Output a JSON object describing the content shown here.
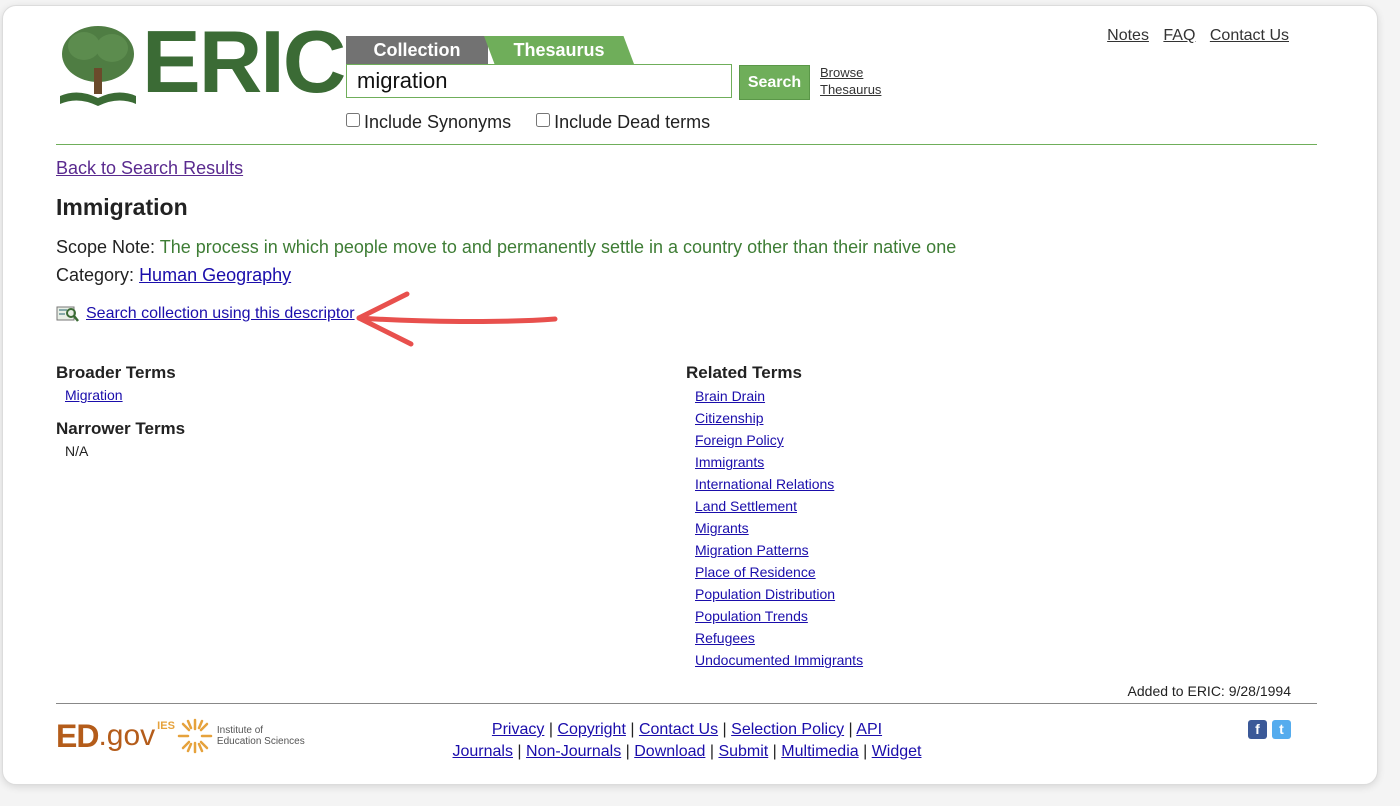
{
  "header": {
    "logo_text": "ERIC",
    "tabs": [
      {
        "label": "Collection"
      },
      {
        "label": "Thesaurus"
      }
    ],
    "search_value": "migration",
    "search_button": "Search",
    "browse_line1": "Browse",
    "browse_line2": "Thesaurus",
    "options": [
      {
        "label": "Include Synonyms",
        "checked": false
      },
      {
        "label": "Include Dead terms",
        "checked": false
      }
    ],
    "top_links": [
      "Notes",
      "FAQ",
      "Contact Us"
    ]
  },
  "content": {
    "back_link": "Back to Search Results",
    "title": "Immigration",
    "scope_label": "Scope Note:",
    "scope_value": "The process in which people move to and permanently settle in a country other than their native one",
    "category_label": "Category:",
    "category_value": "Human Geography",
    "search_descriptor": "Search collection using this descriptor",
    "broader_heading": "Broader Terms",
    "broader_terms": [
      "Migration"
    ],
    "narrower_heading": "Narrower Terms",
    "narrower_terms": [
      "N/A"
    ],
    "related_heading": "Related Terms",
    "related_terms": [
      "Brain Drain",
      "Citizenship",
      "Foreign Policy",
      "Immigrants",
      "International Relations",
      "Land Settlement",
      "Migrants",
      "Migration Patterns",
      "Place of Residence",
      "Population Distribution",
      "Population Trends",
      "Refugees",
      "Undocumented Immigrants"
    ],
    "added": "Added to ERIC: 9/28/1994"
  },
  "footer": {
    "ed": "ED",
    "gov": ".gov",
    "ies": "IES",
    "ies_line1": "Institute of",
    "ies_line2": "Education Sciences",
    "row1": [
      "Privacy",
      "Copyright",
      "Contact Us",
      "Selection Policy",
      "API"
    ],
    "row2": [
      "Journals",
      "Non-Journals",
      "Download",
      "Submit",
      "Multimedia",
      "Widget"
    ],
    "social": [
      {
        "name": "facebook",
        "glyph": "f"
      },
      {
        "name": "twitter",
        "glyph": "t"
      }
    ]
  },
  "colors": {
    "brand_green": "#3b6b35",
    "tab_green": "#6fae5a",
    "tab_gray": "#727272",
    "scope_green": "#3e7d35",
    "annotation_red": "#e8504d"
  }
}
